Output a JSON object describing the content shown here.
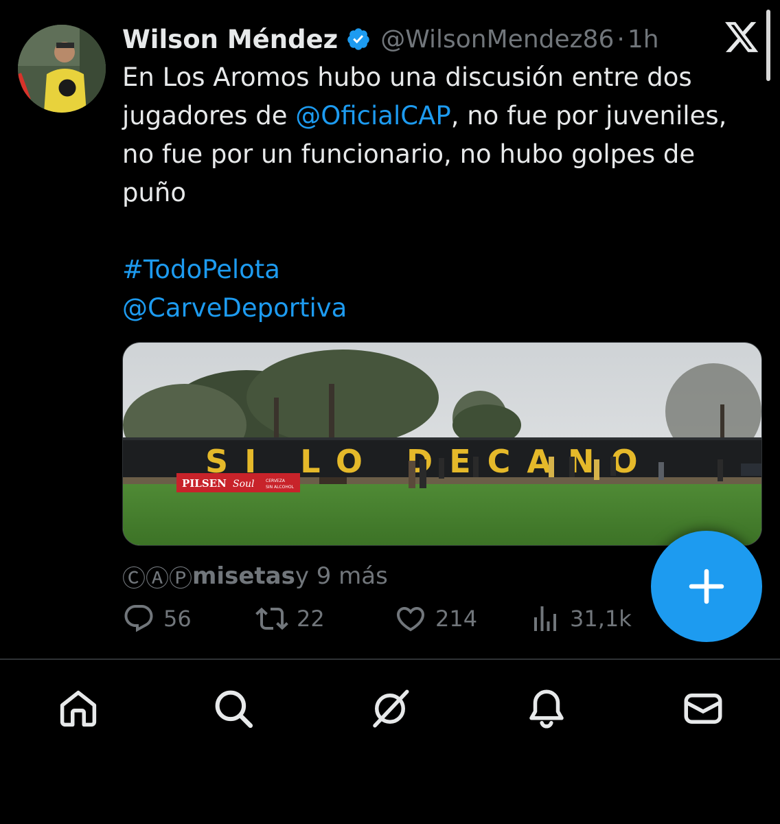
{
  "tweet": {
    "display_name": "Wilson Méndez",
    "handle": "@WilsonMendez86",
    "separator": "·",
    "time": "1h",
    "text": {
      "line1": "En Los Aromos hubo una discusión entre dos",
      "line2_pre": "jugadores de ",
      "line2_mention": "@OficialCAP",
      "line2_post": ", no fue por juveniles,",
      "line3": "no fue por un funcionario, no hubo golpes de",
      "line4": "puño",
      "hashtag": "#TodoPelota",
      "mention2": "@CarveDeportiva"
    },
    "media": {
      "banner_text": "SI LO DECANO",
      "sign_brand": "PILSEN",
      "sign_script": "Soul",
      "sign_small1": "CERVEZA",
      "sign_small2": "SIN ALCOHOL"
    },
    "reactions": {
      "glyphs": "ⒸⒶⓅ",
      "name": "misetas",
      "suffix": " y 9 más"
    },
    "actions": {
      "replies": "56",
      "retweets": "22",
      "likes": "214",
      "views": "31,1k"
    }
  },
  "icons": {
    "verified": "verified-badge-icon",
    "x_logo": "x-logo-icon",
    "fab": "plus-icon",
    "nav": [
      "home-icon",
      "search-icon",
      "grok-icon",
      "bell-icon",
      "mail-icon"
    ]
  },
  "colors": {
    "background": "#000000",
    "text": "#e7e9ea",
    "secondary": "#71767b",
    "accent": "#1d9bf0"
  }
}
